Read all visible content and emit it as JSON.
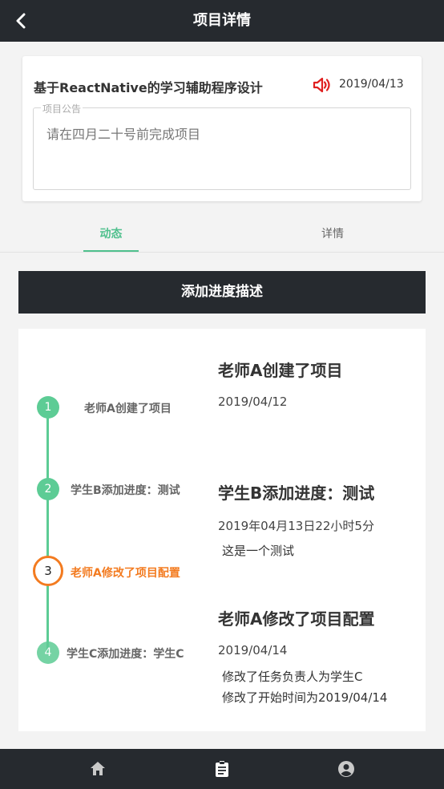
{
  "header": {
    "title": "项目详情",
    "back_icon": "chevron-left-icon"
  },
  "project": {
    "title": "基于ReactNative的学习辅助程序设计",
    "date": "2019/04/13",
    "speaker_icon": "speaker-icon",
    "speaker_color": "#e02020",
    "notice_label": "项目公告",
    "notice_text": "请在四月二十号前完成项目"
  },
  "tabs": [
    {
      "label": "动态",
      "active": true
    },
    {
      "label": "详情",
      "active": false
    }
  ],
  "add_button": {
    "label": "添加进度描述"
  },
  "timeline": {
    "steps": [
      {
        "number": "1",
        "label": "老师A创建了项目"
      },
      {
        "number": "2",
        "label": "学生B添加进度：测试"
      },
      {
        "number": "3",
        "label": "老师A修改了项目配置",
        "current": true
      },
      {
        "number": "4",
        "label": "学生C添加进度：学生C"
      }
    ],
    "events": [
      {
        "title": "老师A创建了项目",
        "date": "2019/04/12",
        "details": []
      },
      {
        "title": "学生B添加进度：测试",
        "date": "2019年04月13日22小时5分",
        "details": [
          "这是一个测试"
        ]
      },
      {
        "title": "老师A修改了项目配置",
        "date": "2019/04/14",
        "details": [
          "修改了任务负责人为学生C",
          "修改了开始时间为2019/04/14"
        ]
      }
    ]
  },
  "bottom_nav": [
    {
      "icon": "home-icon"
    },
    {
      "icon": "clipboard-icon",
      "active": true
    },
    {
      "icon": "user-icon"
    }
  ],
  "colors": {
    "accent": "#4fc08d",
    "current_step": "#f37b20",
    "dark_bar": "#262a2f"
  }
}
